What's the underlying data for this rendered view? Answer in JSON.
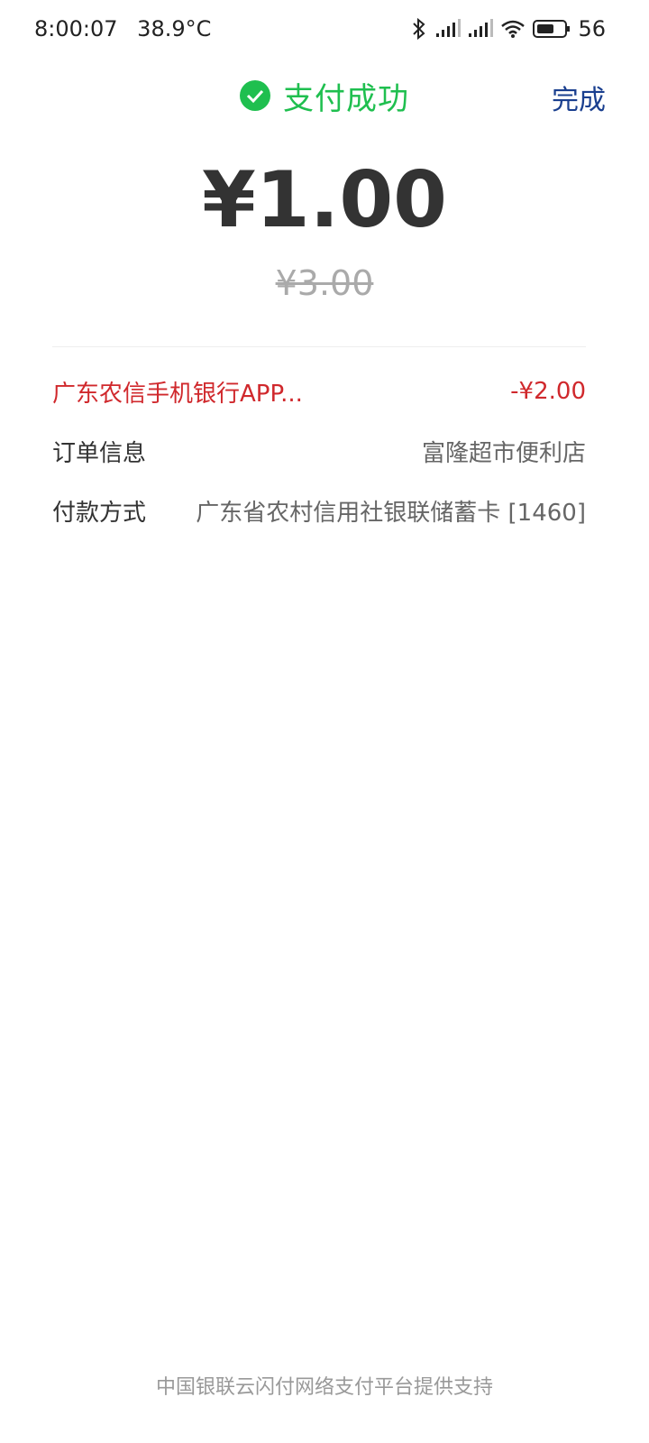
{
  "status_bar": {
    "time": "8:00:07",
    "temperature": "38.9°C",
    "battery": "56"
  },
  "header": {
    "title": "支付成功",
    "done_label": "完成",
    "success_color": "#1fbf4f"
  },
  "payment": {
    "amount": "¥1.00",
    "original_amount": "¥3.00"
  },
  "details": {
    "discount_label": "广东农信手机银行APP...",
    "discount_value": "-¥2.00",
    "order_label": "订单信息",
    "order_value": "富隆超市便利店",
    "method_label": "付款方式",
    "method_value": "广东省农村信用社银联储蓄卡 [1460]"
  },
  "footer": {
    "text": "中国银联云闪付网络支付平台提供支持"
  }
}
